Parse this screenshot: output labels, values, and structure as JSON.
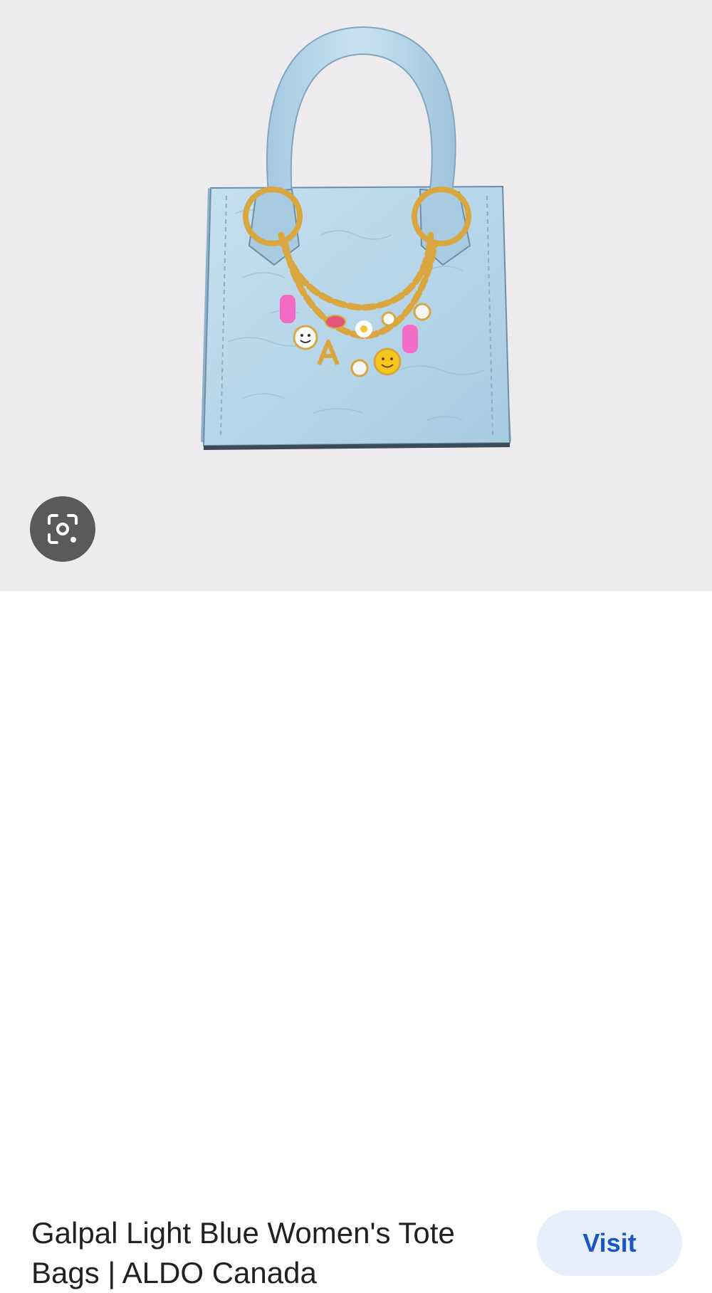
{
  "product_image": {
    "alt": "Light blue croc-embossed tote bag with gold charm chain",
    "background_color": "#eeebef",
    "bag_color": "#b9d7ea",
    "chain_color": "#d9a640"
  },
  "lens": {
    "icon": "lens-icon"
  },
  "result": {
    "title": "Galpal Light Blue Women's Tote Bags | ALDO Canada",
    "visit_label": "Visit"
  }
}
